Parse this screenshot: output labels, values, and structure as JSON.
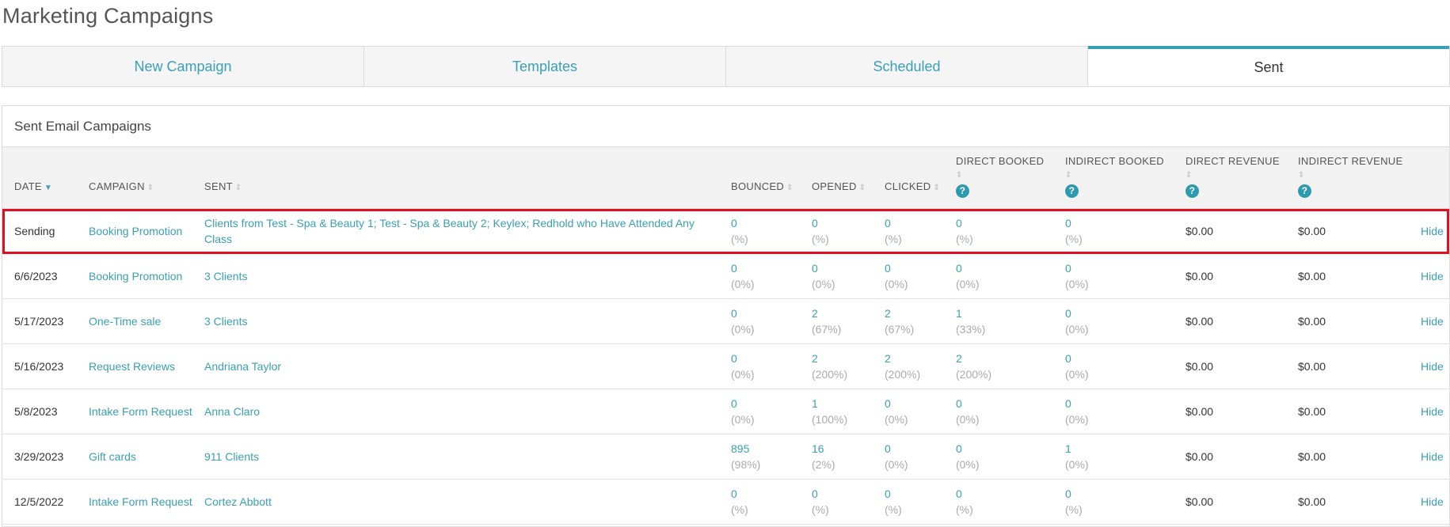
{
  "page": {
    "title": "Marketing Campaigns"
  },
  "tabs": [
    {
      "label": "New Campaign",
      "active": false
    },
    {
      "label": "Templates",
      "active": false
    },
    {
      "label": "Scheduled",
      "active": false
    },
    {
      "label": "Sent",
      "active": true
    }
  ],
  "panel": {
    "heading": "Sent Email Campaigns"
  },
  "columns": {
    "date": "DATE",
    "campaign": "CAMPAIGN",
    "sent": "SENT",
    "bounced": "BOUNCED",
    "opened": "OPENED",
    "clicked": "CLICKED",
    "direct_booked": "DIRECT BOOKED",
    "indirect_booked": "INDIRECT BOOKED",
    "direct_revenue": "DIRECT REVENUE",
    "indirect_revenue": "INDIRECT REVENUE",
    "help_glyph": "?"
  },
  "icons": {
    "sort_active": "caret-down-icon",
    "sort_inactive": "sort-icon",
    "help": "help-circle-icon"
  },
  "colors": {
    "accent": "#3a9fb4",
    "highlight": "#e01020",
    "header_bg": "#f2f2f2"
  },
  "rows": [
    {
      "date": "Sending",
      "campaign": "Booking Promotion",
      "sent": "Clients from Test - Spa & Beauty 1; Test - Spa & Beauty 2; Keylex; Redhold who Have Attended Any Class",
      "bounced": "0",
      "bounced_pct": "(%)",
      "opened": "0",
      "opened_pct": "(%)",
      "clicked": "0",
      "clicked_pct": "(%)",
      "direct_booked": "0",
      "direct_booked_pct": "(%)",
      "indirect_booked": "0",
      "indirect_booked_pct": "(%)",
      "direct_revenue": "$0.00",
      "indirect_revenue": "$0.00",
      "action": "Hide",
      "highlighted": true
    },
    {
      "date": "6/6/2023",
      "campaign": "Booking Promotion",
      "sent": "3 Clients",
      "bounced": "0",
      "bounced_pct": "(0%)",
      "opened": "0",
      "opened_pct": "(0%)",
      "clicked": "0",
      "clicked_pct": "(0%)",
      "direct_booked": "0",
      "direct_booked_pct": "(0%)",
      "indirect_booked": "0",
      "indirect_booked_pct": "(0%)",
      "direct_revenue": "$0.00",
      "indirect_revenue": "$0.00",
      "action": "Hide",
      "highlighted": false
    },
    {
      "date": "5/17/2023",
      "campaign": "One-Time sale",
      "sent": "3 Clients",
      "bounced": "0",
      "bounced_pct": "(0%)",
      "opened": "2",
      "opened_pct": "(67%)",
      "clicked": "2",
      "clicked_pct": "(67%)",
      "direct_booked": "1",
      "direct_booked_pct": "(33%)",
      "indirect_booked": "0",
      "indirect_booked_pct": "(0%)",
      "direct_revenue": "$0.00",
      "indirect_revenue": "$0.00",
      "action": "Hide",
      "highlighted": false
    },
    {
      "date": "5/16/2023",
      "campaign": "Request Reviews",
      "sent": "Andriana Taylor",
      "bounced": "0",
      "bounced_pct": "(0%)",
      "opened": "2",
      "opened_pct": "(200%)",
      "clicked": "2",
      "clicked_pct": "(200%)",
      "direct_booked": "2",
      "direct_booked_pct": "(200%)",
      "indirect_booked": "0",
      "indirect_booked_pct": "(0%)",
      "direct_revenue": "$0.00",
      "indirect_revenue": "$0.00",
      "action": "Hide",
      "highlighted": false
    },
    {
      "date": "5/8/2023",
      "campaign": "Intake Form Request",
      "sent": "Anna Claro",
      "bounced": "0",
      "bounced_pct": "(0%)",
      "opened": "1",
      "opened_pct": "(100%)",
      "clicked": "0",
      "clicked_pct": "(0%)",
      "direct_booked": "0",
      "direct_booked_pct": "(0%)",
      "indirect_booked": "0",
      "indirect_booked_pct": "(0%)",
      "direct_revenue": "$0.00",
      "indirect_revenue": "$0.00",
      "action": "Hide",
      "highlighted": false
    },
    {
      "date": "3/29/2023",
      "campaign": "Gift cards",
      "sent": "911 Clients",
      "bounced": "895",
      "bounced_pct": "(98%)",
      "opened": "16",
      "opened_pct": "(2%)",
      "clicked": "0",
      "clicked_pct": "(0%)",
      "direct_booked": "0",
      "direct_booked_pct": "(0%)",
      "indirect_booked": "1",
      "indirect_booked_pct": "(0%)",
      "direct_revenue": "$0.00",
      "indirect_revenue": "$0.00",
      "action": "Hide",
      "highlighted": false
    },
    {
      "date": "12/5/2022",
      "campaign": "Intake Form Request",
      "sent": "Cortez Abbott",
      "bounced": "0",
      "bounced_pct": "(%)",
      "opened": "0",
      "opened_pct": "(%)",
      "clicked": "0",
      "clicked_pct": "(%)",
      "direct_booked": "0",
      "direct_booked_pct": "(%)",
      "indirect_booked": "0",
      "indirect_booked_pct": "(%)",
      "direct_revenue": "$0.00",
      "indirect_revenue": "$0.00",
      "action": "Hide",
      "highlighted": false
    }
  ]
}
